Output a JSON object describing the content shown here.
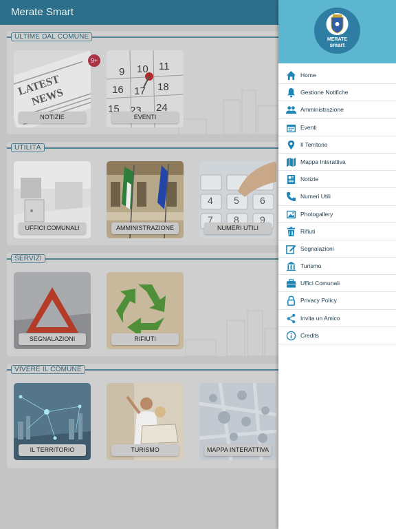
{
  "app": {
    "title": "Merate Smart"
  },
  "colors": {
    "topbar": "#2c6f8a",
    "drawer_header": "#5cb6cf",
    "accent": "#1e86b7",
    "badge": "#a83345"
  },
  "sections": [
    {
      "title": "ULTIME DAL COMUNE",
      "tiles": [
        {
          "label": "NOTIZIE",
          "badge": "9+",
          "icon": "newspaper-image"
        },
        {
          "label": "EVENTI",
          "icon": "calendar-image"
        }
      ]
    },
    {
      "title": "UTILITÀ",
      "tiles": [
        {
          "label": "UFFICI COMUNALI",
          "icon": "office-image"
        },
        {
          "label": "AMMINISTRAZIONE",
          "icon": "flags-image"
        },
        {
          "label": "NUMERI UTILI",
          "icon": "keypad-image"
        }
      ]
    },
    {
      "title": "SERVIZI",
      "tiles": [
        {
          "label": "SEGNALAZIONI",
          "icon": "warning-triangle-image"
        },
        {
          "label": "RIFIUTI",
          "icon": "recycle-image"
        }
      ]
    },
    {
      "title": "VIVERE IL COMUNE",
      "tiles": [
        {
          "label": "IL TERRITORIO",
          "icon": "network-city-image"
        },
        {
          "label": "TURISMO",
          "icon": "tourists-image"
        },
        {
          "label": "MAPPA INTERATTIVA",
          "icon": "map-image"
        }
      ]
    }
  ],
  "drawer": {
    "logo_line1": "MERATE",
    "logo_line2": "smart",
    "items": [
      {
        "label": "Home",
        "icon": "home-icon"
      },
      {
        "label": "Gestione Notifiche",
        "icon": "bell-icon"
      },
      {
        "label": "Amministrazione",
        "icon": "people-icon"
      },
      {
        "label": "Eventi",
        "icon": "calendar-icon"
      },
      {
        "label": "Il Territorio",
        "icon": "map-pin-icon"
      },
      {
        "label": "Mappa Interattiva",
        "icon": "map-icon"
      },
      {
        "label": "Notizie",
        "icon": "newspaper-icon"
      },
      {
        "label": "Numeri Utili",
        "icon": "phone-icon"
      },
      {
        "label": "Photogallery",
        "icon": "photo-icon"
      },
      {
        "label": "Rifiuti",
        "icon": "trash-icon"
      },
      {
        "label": "Segnalazioni",
        "icon": "edit-icon"
      },
      {
        "label": "Turismo",
        "icon": "museum-icon"
      },
      {
        "label": "Uffici Comunali",
        "icon": "briefcase-icon"
      },
      {
        "label": "Privacy Policy",
        "icon": "lock-icon"
      },
      {
        "label": "Invita un Amico",
        "icon": "share-icon"
      },
      {
        "label": "Credits",
        "icon": "info-icon"
      }
    ]
  }
}
